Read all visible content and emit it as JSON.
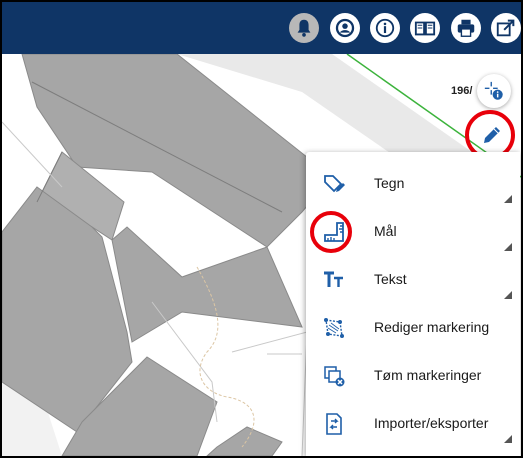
{
  "colors": {
    "topbar": "#0f3566",
    "icon_blue": "#1f5fa8",
    "highlight_red": "#e8000a",
    "building_gray": "#a6a6a6",
    "route_green": "#3cb33c"
  },
  "toolbar": {
    "buttons": [
      {
        "icon": "bell-icon",
        "active": true
      },
      {
        "icon": "user-icon"
      },
      {
        "icon": "info-icon"
      },
      {
        "icon": "book-icon"
      },
      {
        "icon": "print-icon"
      },
      {
        "icon": "share-icon"
      }
    ]
  },
  "map": {
    "scale_text": "196/"
  },
  "draw_menu": {
    "items": [
      {
        "label": "Tegn",
        "icon": "tag-pen-icon",
        "has_submenu": true
      },
      {
        "label": "Mål",
        "icon": "ruler-icon",
        "has_submenu": true,
        "highlighted": true
      },
      {
        "label": "Tekst",
        "icon": "text-icon",
        "has_submenu": true
      },
      {
        "label": "Rediger markering",
        "icon": "edit-shape-icon",
        "has_submenu": false
      },
      {
        "label": "Tøm markeringer",
        "icon": "clear-markings-icon",
        "has_submenu": false
      },
      {
        "label": "Importer/eksporter",
        "icon": "import-export-icon",
        "has_submenu": true
      }
    ]
  }
}
